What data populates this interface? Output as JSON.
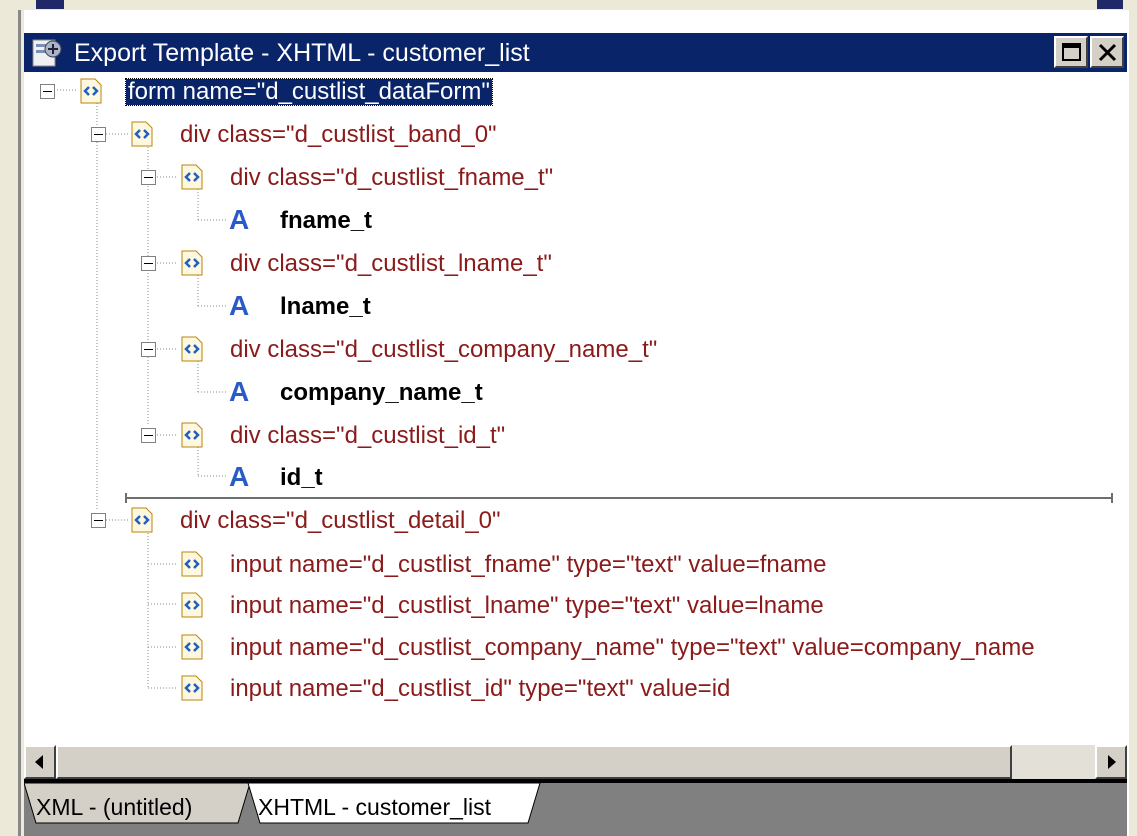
{
  "window": {
    "title": "Export Template - XHTML - customer_list"
  },
  "tree": {
    "root": {
      "label": "form name=\"d_custlist_dataForm\"",
      "icon": "xml-node-icon"
    },
    "band": {
      "label": "div class=\"d_custlist_band_0\"",
      "children": [
        {
          "label": "div class=\"d_custlist_fname_t\"",
          "field": "fname_t"
        },
        {
          "label": "div class=\"d_custlist_lname_t\"",
          "field": "lname_t"
        },
        {
          "label": "div class=\"d_custlist_company_name_t\"",
          "field": "company_name_t"
        },
        {
          "label": "div class=\"d_custlist_id_t\"",
          "field": "id_t"
        }
      ]
    },
    "detail": {
      "label": "div class=\"d_custlist_detail_0\"",
      "children": [
        "input name=\"d_custlist_fname\" type=\"text\" value=fname",
        "input name=\"d_custlist_lname\" type=\"text\" value=lname",
        "input name=\"d_custlist_company_name\" type=\"text\" value=company_name",
        "input name=\"d_custlist_id\" type=\"text\" value=id"
      ]
    }
  },
  "tabs": [
    {
      "label": "XML - (untitled)",
      "active": false
    },
    {
      "label": "XHTML - customer_list",
      "active": true
    }
  ],
  "colors": {
    "titlebar": "#0a246a",
    "node_label": "#8b1a1a",
    "field_icon": "#2a5ac8"
  }
}
